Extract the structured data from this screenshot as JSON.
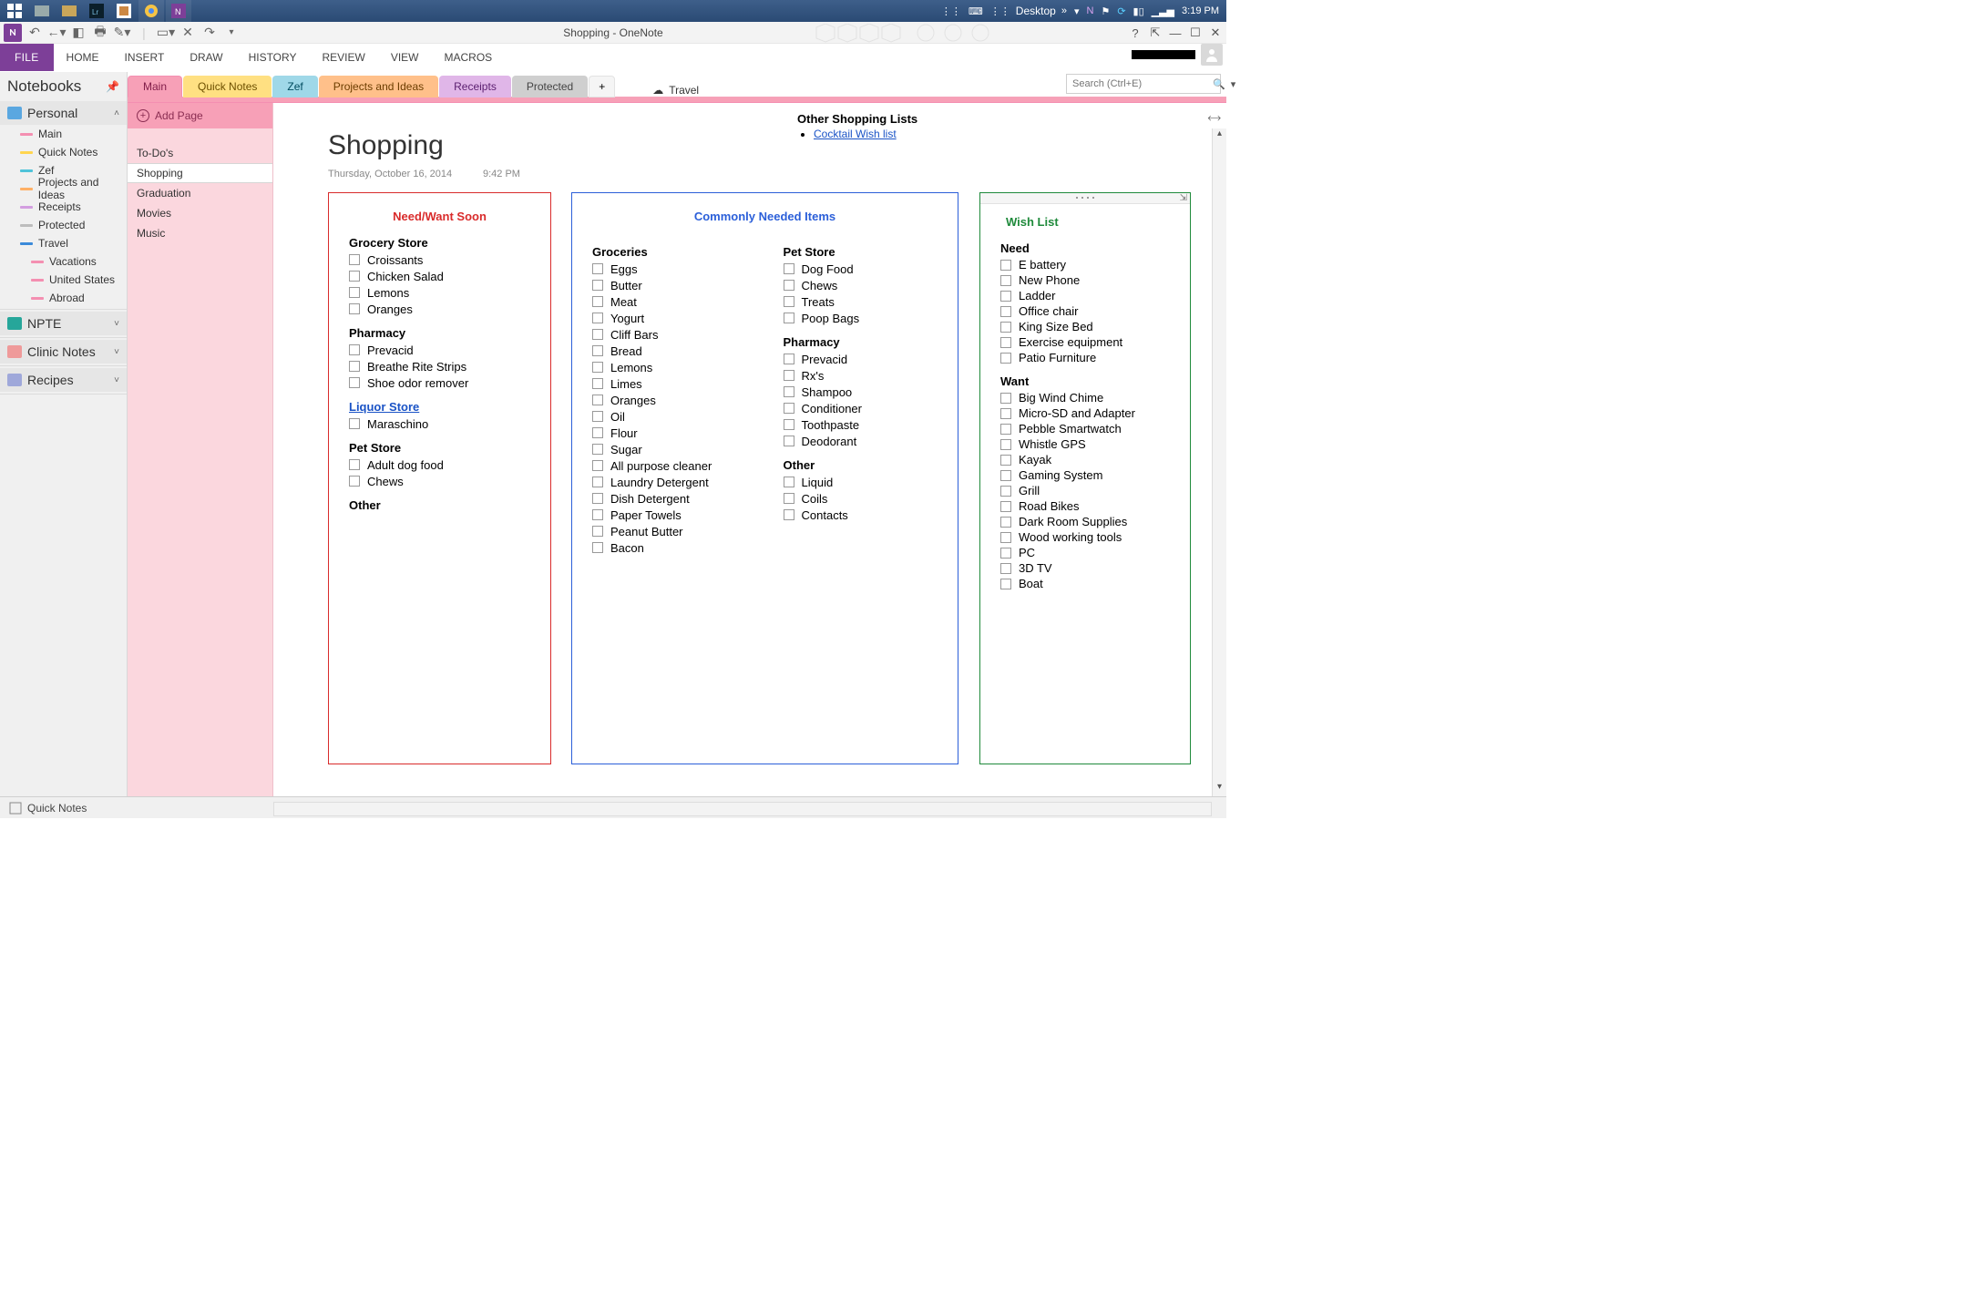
{
  "taskbar": {
    "desktop_label": "Desktop",
    "clock": "3:19 PM"
  },
  "window": {
    "title": "Shopping - OneNote"
  },
  "ribbon": {
    "file": "FILE",
    "tabs": [
      "HOME",
      "INSERT",
      "DRAW",
      "HISTORY",
      "REVIEW",
      "VIEW",
      "MACROS"
    ]
  },
  "notebooks": {
    "header": "Notebooks",
    "groups": [
      {
        "name": "Personal",
        "color": "#5aa7e0",
        "expanded": true,
        "sections": [
          {
            "name": "Main",
            "color": "#f48fb1"
          },
          {
            "name": "Quick Notes",
            "color": "#ffd54f"
          },
          {
            "name": "Zef",
            "color": "#4fc3d9"
          },
          {
            "name": "Projects and Ideas",
            "color": "#ffb066"
          },
          {
            "name": "Receipts",
            "color": "#d39ee0"
          },
          {
            "name": "Protected",
            "color": "#bdbdbd"
          },
          {
            "name": "Travel",
            "color": "#3b8ad9",
            "children": [
              {
                "name": "Vacations",
                "color": "#f48fb1"
              },
              {
                "name": "United States",
                "color": "#f48fb1"
              },
              {
                "name": "Abroad",
                "color": "#f48fb1"
              }
            ]
          }
        ]
      },
      {
        "name": "NPTE",
        "color": "#26a69a",
        "expanded": false
      },
      {
        "name": "Clinic Notes",
        "color": "#ef9a9a",
        "expanded": false
      },
      {
        "name": "Recipes",
        "color": "#9fa8da",
        "expanded": false
      }
    ],
    "footer": "Quick Notes"
  },
  "section_tabs": [
    "Main",
    "Quick Notes",
    "Zef",
    "Projects and Ideas",
    "Receipts",
    "Protected"
  ],
  "section_extra_tab": "Travel",
  "search_placeholder": "Search (Ctrl+E)",
  "pages": {
    "add_label": "Add Page",
    "items": [
      "To-Do's",
      "Shopping",
      "Graduation",
      "Movies",
      "Music"
    ],
    "selected": "Shopping"
  },
  "page": {
    "title": "Shopping",
    "date": "Thursday, October 16, 2014",
    "time": "9:42 PM",
    "other_lists": {
      "header": "Other Shopping Lists",
      "items": [
        "Cocktail Wish list"
      ]
    },
    "red": {
      "title": "Need/Want Soon",
      "sections": [
        {
          "header": "Grocery Store",
          "items": [
            "Croissants",
            "Chicken Salad",
            "Lemons",
            "Oranges"
          ]
        },
        {
          "header": "Pharmacy",
          "items": [
            "Prevacid",
            "Breathe Rite Strips",
            "Shoe odor remover"
          ]
        },
        {
          "header": "Liquor Store",
          "link": true,
          "items": [
            "Maraschino"
          ]
        },
        {
          "header": "Pet Store",
          "items": [
            "Adult dog food",
            "Chews"
          ]
        },
        {
          "header": "Other",
          "items": []
        }
      ]
    },
    "blue": {
      "title": "Commonly Needed Items",
      "left": [
        {
          "header": "Groceries",
          "items": [
            "Eggs",
            "Butter",
            "Meat",
            "Yogurt",
            "Cliff Bars",
            "Bread",
            "Lemons",
            "Limes",
            "Oranges",
            "Oil",
            "Flour",
            "Sugar",
            "All purpose cleaner",
            "Laundry Detergent",
            "Dish Detergent",
            "Paper Towels",
            "Peanut Butter",
            "Bacon"
          ]
        }
      ],
      "right": [
        {
          "header": "Pet Store",
          "items": [
            "Dog Food",
            "Chews",
            "Treats",
            "Poop Bags"
          ]
        },
        {
          "header": "Pharmacy",
          "items": [
            "Prevacid",
            "Rx's",
            "Shampoo",
            "Conditioner",
            "Toothpaste",
            "Deodorant"
          ]
        },
        {
          "header": "Other",
          "items": [
            "Liquid",
            "Coils",
            "Contacts"
          ]
        }
      ]
    },
    "green": {
      "title": "Wish List",
      "sections": [
        {
          "header": "Need",
          "items": [
            "E battery",
            "New Phone",
            "Ladder",
            "Office chair",
            "King Size Bed",
            "Exercise equipment",
            "Patio Furniture"
          ]
        },
        {
          "header": "Want",
          "items": [
            "Big Wind Chime",
            "Micro-SD and Adapter",
            "Pebble Smartwatch",
            "Whistle GPS",
            "Kayak",
            "Gaming System",
            "Grill",
            "Road Bikes",
            "Dark Room Supplies",
            "Wood working tools",
            "PC",
            "3D TV",
            "Boat"
          ]
        }
      ]
    }
  }
}
